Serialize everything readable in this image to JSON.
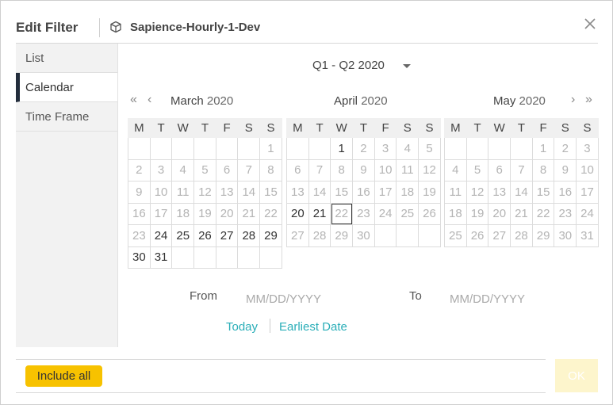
{
  "dialog": {
    "title": "Edit Filter",
    "subtitle": "Sapience-Hourly-1-Dev"
  },
  "sidebar": {
    "items": [
      {
        "label": "List",
        "active": false
      },
      {
        "label": "Calendar",
        "active": true
      },
      {
        "label": "Time Frame",
        "active": false
      }
    ]
  },
  "period": {
    "selected": "Q1 - Q2 2020"
  },
  "nav": {
    "prev_year": "«",
    "prev_month": "‹",
    "next_month": "›",
    "next_year": "»"
  },
  "weekdays": [
    "M",
    "T",
    "W",
    "T",
    "F",
    "S",
    "S"
  ],
  "calendars": [
    {
      "month": "March",
      "year": "2020",
      "weeks": [
        [
          {
            "d": ""
          },
          {
            "d": ""
          },
          {
            "d": ""
          },
          {
            "d": ""
          },
          {
            "d": ""
          },
          {
            "d": ""
          },
          {
            "d": "1"
          }
        ],
        [
          {
            "d": "2"
          },
          {
            "d": "3"
          },
          {
            "d": "4"
          },
          {
            "d": "5"
          },
          {
            "d": "6"
          },
          {
            "d": "7"
          },
          {
            "d": "8"
          }
        ],
        [
          {
            "d": "9"
          },
          {
            "d": "10"
          },
          {
            "d": "11"
          },
          {
            "d": "12"
          },
          {
            "d": "13"
          },
          {
            "d": "14"
          },
          {
            "d": "15"
          }
        ],
        [
          {
            "d": "16"
          },
          {
            "d": "17"
          },
          {
            "d": "18"
          },
          {
            "d": "19"
          },
          {
            "d": "20"
          },
          {
            "d": "21"
          },
          {
            "d": "22"
          }
        ],
        [
          {
            "d": "23"
          },
          {
            "d": "24",
            "on": true
          },
          {
            "d": "25",
            "on": true
          },
          {
            "d": "26",
            "on": true
          },
          {
            "d": "27",
            "on": true
          },
          {
            "d": "28",
            "on": true
          },
          {
            "d": "29",
            "on": true
          }
        ],
        [
          {
            "d": "30",
            "on": true
          },
          {
            "d": "31",
            "on": true
          },
          {
            "d": ""
          },
          {
            "d": ""
          },
          {
            "d": ""
          },
          {
            "d": ""
          },
          {
            "d": ""
          }
        ]
      ]
    },
    {
      "month": "April",
      "year": "2020",
      "weeks": [
        [
          {
            "d": ""
          },
          {
            "d": ""
          },
          {
            "d": "1",
            "on": true
          },
          {
            "d": "2"
          },
          {
            "d": "3"
          },
          {
            "d": "4"
          },
          {
            "d": "5"
          }
        ],
        [
          {
            "d": "6"
          },
          {
            "d": "7"
          },
          {
            "d": "8"
          },
          {
            "d": "9"
          },
          {
            "d": "10"
          },
          {
            "d": "11"
          },
          {
            "d": "12"
          }
        ],
        [
          {
            "d": "13"
          },
          {
            "d": "14"
          },
          {
            "d": "15"
          },
          {
            "d": "16"
          },
          {
            "d": "17"
          },
          {
            "d": "18"
          },
          {
            "d": "19"
          }
        ],
        [
          {
            "d": "20",
            "on": true
          },
          {
            "d": "21",
            "on": true
          },
          {
            "d": "22",
            "today": true
          },
          {
            "d": "23"
          },
          {
            "d": "24"
          },
          {
            "d": "25"
          },
          {
            "d": "26"
          }
        ],
        [
          {
            "d": "27"
          },
          {
            "d": "28"
          },
          {
            "d": "29"
          },
          {
            "d": "30"
          },
          {
            "d": ""
          },
          {
            "d": ""
          },
          {
            "d": ""
          }
        ]
      ]
    },
    {
      "month": "May",
      "year": "2020",
      "weeks": [
        [
          {
            "d": ""
          },
          {
            "d": ""
          },
          {
            "d": ""
          },
          {
            "d": ""
          },
          {
            "d": "1"
          },
          {
            "d": "2"
          },
          {
            "d": "3"
          }
        ],
        [
          {
            "d": "4"
          },
          {
            "d": "5"
          },
          {
            "d": "6"
          },
          {
            "d": "7"
          },
          {
            "d": "8"
          },
          {
            "d": "9"
          },
          {
            "d": "10"
          }
        ],
        [
          {
            "d": "11"
          },
          {
            "d": "12"
          },
          {
            "d": "13"
          },
          {
            "d": "14"
          },
          {
            "d": "15"
          },
          {
            "d": "16"
          },
          {
            "d": "17"
          }
        ],
        [
          {
            "d": "18"
          },
          {
            "d": "19"
          },
          {
            "d": "20"
          },
          {
            "d": "21"
          },
          {
            "d": "22"
          },
          {
            "d": "23"
          },
          {
            "d": "24"
          }
        ],
        [
          {
            "d": "25"
          },
          {
            "d": "26"
          },
          {
            "d": "27"
          },
          {
            "d": "28"
          },
          {
            "d": "29"
          },
          {
            "d": "30"
          },
          {
            "d": "31"
          }
        ]
      ]
    }
  ],
  "range": {
    "from_label": "From",
    "from_placeholder": "MM/DD/YYYY",
    "to_label": "To",
    "to_placeholder": "MM/DD/YYYY"
  },
  "links": {
    "today": "Today",
    "earliest": "Earliest Date"
  },
  "footer": {
    "include_all": "Include all",
    "ok": "OK"
  },
  "colors": {
    "accent_yellow": "#f7c200",
    "link_teal": "#2aaeb8",
    "active_marker": "#232d3c"
  }
}
